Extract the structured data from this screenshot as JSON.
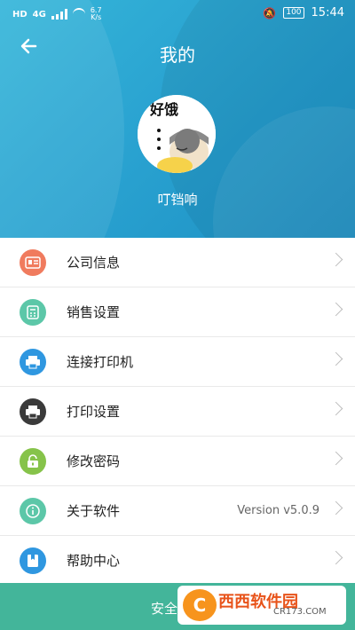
{
  "status": {
    "hd": "HD",
    "network": "4G",
    "speed_value": "6.7",
    "speed_unit": "K/s",
    "battery": "100",
    "time": "15:44"
  },
  "title": "我的",
  "user": {
    "name": "叮铛响"
  },
  "avatar_text": "好饿",
  "menu": [
    {
      "label": "公司信息",
      "icon": "id-card-icon",
      "color": "#f07b5e"
    },
    {
      "label": "销售设置",
      "icon": "calculator-icon",
      "color": "#5cc7a8"
    },
    {
      "label": "连接打印机",
      "icon": "printer-icon",
      "color": "#2f97e0"
    },
    {
      "label": "打印设置",
      "icon": "printer-icon",
      "color": "#3a3a3a"
    },
    {
      "label": "修改密码",
      "icon": "lock-icon",
      "color": "#86c34a"
    },
    {
      "label": "关于软件",
      "icon": "info-icon",
      "color": "#5cc7a8",
      "value": "Version v5.0.9"
    },
    {
      "label": "帮助中心",
      "icon": "book-icon",
      "color": "#2f97e0"
    }
  ],
  "bottom": {
    "label": "安全"
  },
  "watermark": {
    "logo": "C",
    "title": "西西软件园",
    "sub": "CR173.COM"
  }
}
